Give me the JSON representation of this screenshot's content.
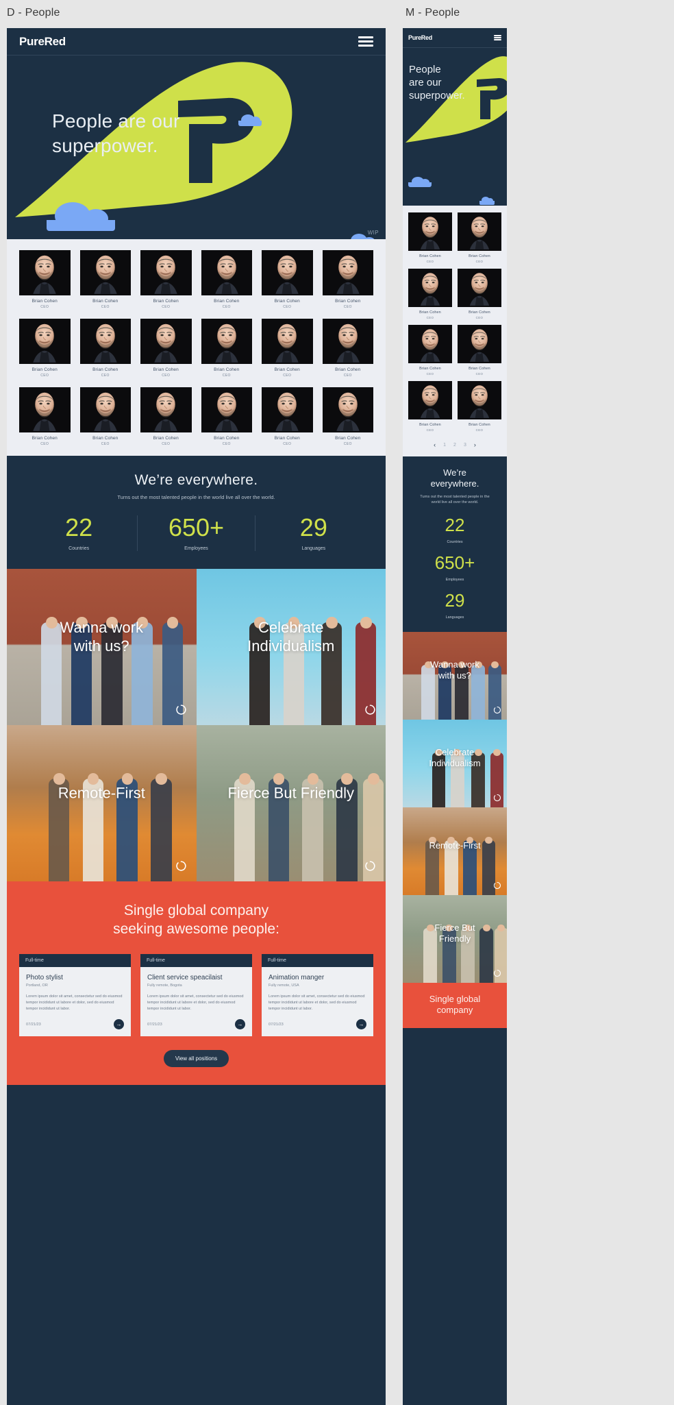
{
  "captions": {
    "desktop": "D - People",
    "mobile": "M - People"
  },
  "brand": "PureRed",
  "icons": {
    "hamburger": "hamburger-menu-icon",
    "arrow": "→",
    "prev": "‹",
    "next": "›"
  },
  "colors": {
    "navy": "#1c3044",
    "lime": "#cfe04a",
    "red": "#e8513c",
    "cloud_blue": "#7aa8f5",
    "light_bg": "#eceef3"
  },
  "hero": {
    "title_line1": "People are our",
    "title_line2": "superpower.",
    "mobile_line1": "People",
    "mobile_line2": "are our",
    "mobile_line3": "superpower.",
    "wip": "WIP"
  },
  "team": {
    "member": {
      "name": "Brian Cohen",
      "role": "CEO"
    },
    "desktop_count": 18,
    "mobile_count": 8,
    "pagination": {
      "prev": "‹",
      "pages": [
        "1",
        "2",
        "3"
      ],
      "next": "›",
      "active": "1"
    }
  },
  "stats": {
    "heading": "We’re everywhere.",
    "mobile_heading_l1": "We’re",
    "mobile_heading_l2": "everywhere.",
    "subheading": "Turns out the most talented people in the world live all over the world.",
    "items": [
      {
        "value": "22",
        "label": "Countries"
      },
      {
        "value": "650+",
        "label": "Employees"
      },
      {
        "value": "29",
        "label": "Languages"
      }
    ]
  },
  "tiles": [
    {
      "title_l1": "Wanna work",
      "title_l2": "with us?",
      "theme": "brick"
    },
    {
      "title_l1": "Celebrate",
      "title_l2": "Individualism",
      "theme": "sky"
    },
    {
      "title_l1": "Remote-First",
      "title_l2": "",
      "theme": "living"
    },
    {
      "title_l1": "Fierce But Friendly",
      "title_l2": "",
      "theme": "outdoor"
    }
  ],
  "tiles_mobile": [
    {
      "title_l1": "Wanna work",
      "title_l2": "with us?",
      "theme": "brick"
    },
    {
      "title_l1": "Celebrate",
      "title_l2": "Individualism",
      "theme": "sky"
    },
    {
      "title_l1": "Remote-First",
      "title_l2": "",
      "theme": "living"
    },
    {
      "title_l1": "Fierce But",
      "title_l2": "Friendly",
      "theme": "outdoor"
    }
  ],
  "jobs": {
    "heading_l1": "Single global company",
    "heading_l2": "seeking awesome people:",
    "mobile_heading_l1": "Single global",
    "mobile_heading_l2": "company",
    "cta": "View all positions",
    "cards": [
      {
        "tag": "Full-time",
        "title": "Photo stylist",
        "location": "Portland, OR",
        "description": "Lorem ipsum dolor sit amet, consectetur sed do eiusmod tempor incididunt ut labore et dolor, sed do eiusmod tempor incididunt ut labor.",
        "date": "07/21/23"
      },
      {
        "tag": "Full-time",
        "title": "Client service speacilaist",
        "location": "Fully remote, Bogota",
        "description": "Lorem ipsum dolor sit amet, consectetur sed do eiusmod tempor incididunt ut labore et dolor, sed do eiusmod tempor incididunt ut labor.",
        "date": "07/21/23"
      },
      {
        "tag": "Full-time",
        "title": "Animation manger",
        "location": "Fully remote, USA",
        "description": "Lorem ipsum dolor sit amet, consectetur sed do eiusmod tempor incididunt ut labore et dolor, sed do eiusmod tempor incididunt ut labor.",
        "date": "07/21/23"
      }
    ]
  }
}
